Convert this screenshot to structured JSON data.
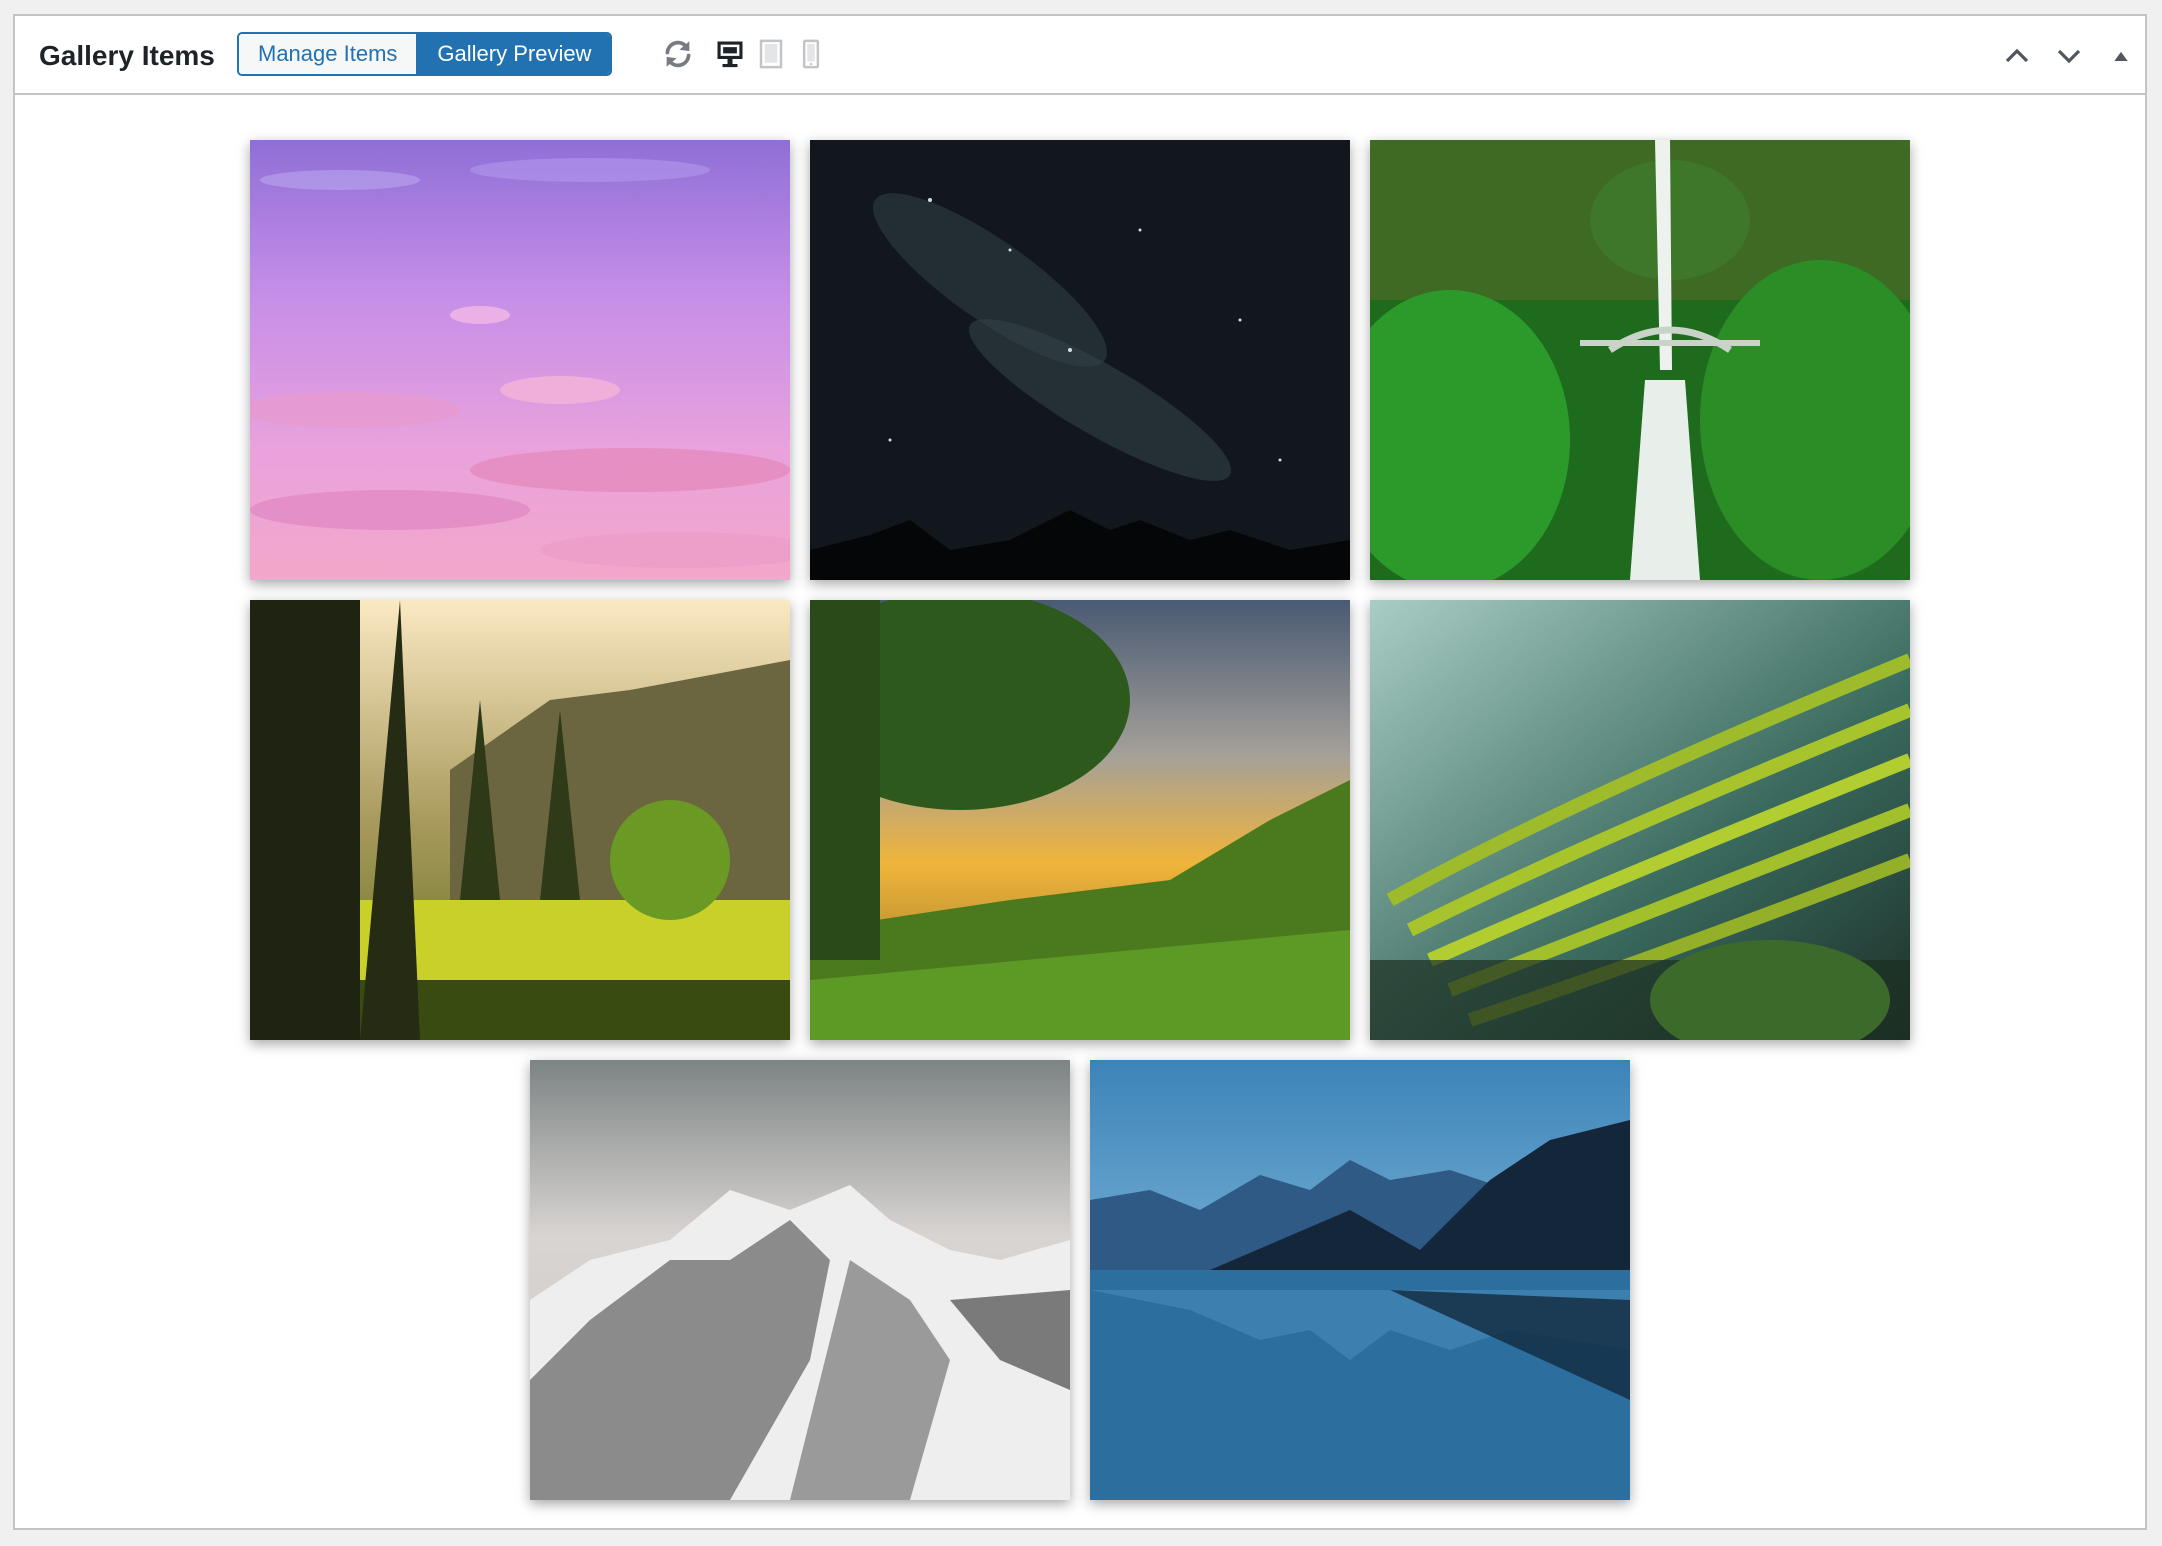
{
  "panel": {
    "title": "Gallery Items",
    "tabs": [
      {
        "label": "Manage Items",
        "active": false
      },
      {
        "label": "Gallery Preview",
        "active": true
      }
    ],
    "toolbar_icons": [
      "refresh-icon",
      "desktop-icon",
      "tablet-icon",
      "mobile-icon"
    ],
    "controls": [
      "move-up-icon",
      "move-down-icon",
      "collapse-icon"
    ]
  },
  "colors": {
    "accent": "#2271b1",
    "border": "#c3c4c7",
    "text": "#1d2327"
  },
  "gallery": {
    "items": [
      {
        "subject": "pink-purple sunset sky with clouds"
      },
      {
        "subject": "night sky milky way over dark rocks"
      },
      {
        "subject": "waterfall with arched bridge in green forest"
      },
      {
        "subject": "pine trees in sunny meadow with mountains"
      },
      {
        "subject": "tree over green valley at golden sunset"
      },
      {
        "subject": "terraced green rice fields on hillside"
      },
      {
        "subject": "snow-covered rocky mountain peaks"
      },
      {
        "subject": "blue mountain lake with reflection"
      }
    ]
  }
}
